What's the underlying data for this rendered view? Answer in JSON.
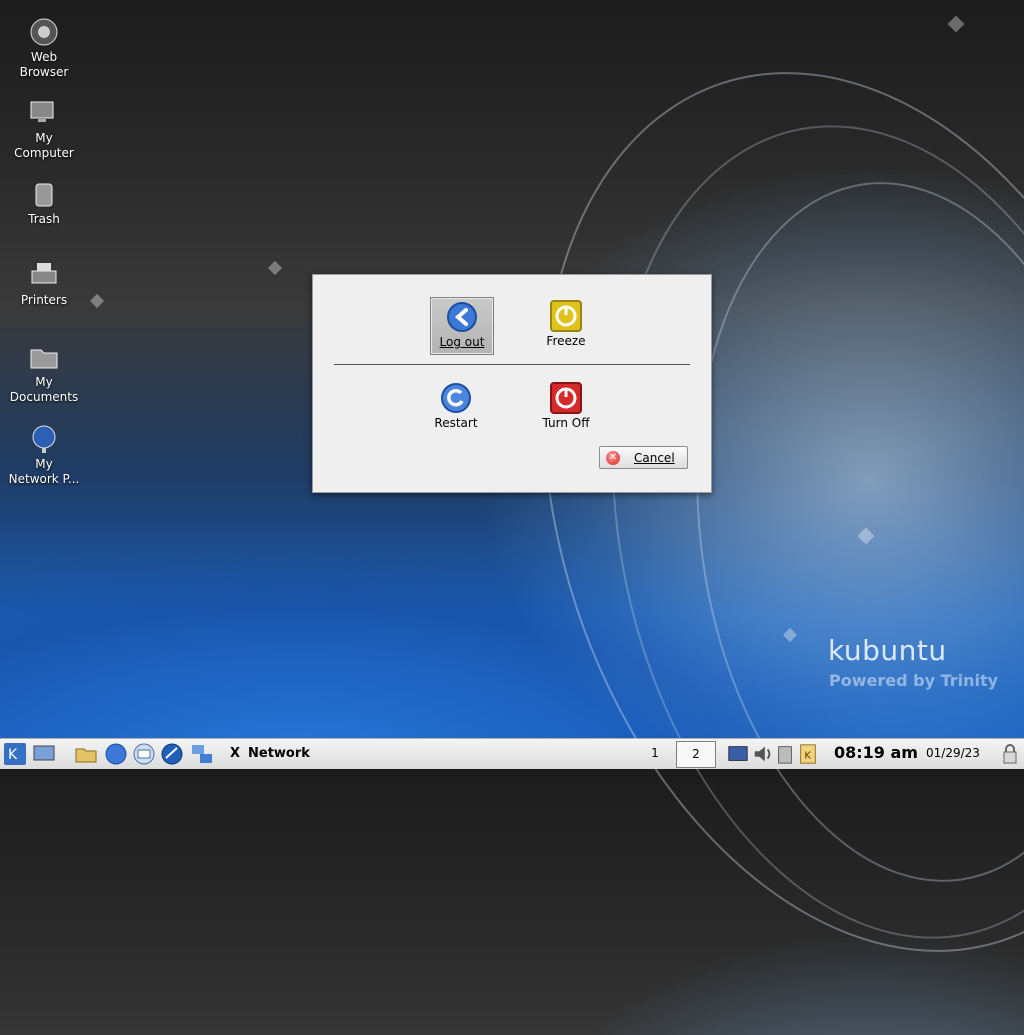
{
  "desktop": {
    "icons": [
      {
        "label": "Web\nBrowser",
        "icon": "web-browser-icon"
      },
      {
        "label": "My\nComputer",
        "icon": "computer-icon"
      },
      {
        "label": "Trash",
        "icon": "trash-icon"
      },
      {
        "label": "Printers",
        "icon": "printer-icon"
      },
      {
        "label": "My\nDocuments",
        "icon": "folder-icon"
      },
      {
        "label": "My\nNetwork P...",
        "icon": "network-globe-icon"
      }
    ]
  },
  "dialog": {
    "logout": "Log out",
    "freeze": "Freeze",
    "restart": "Restart",
    "turnoff": "Turn Off",
    "cancel": "Cancel"
  },
  "branding": {
    "name": "kubuntu",
    "sub": "Powered by Trinity"
  },
  "taskbar": {
    "task_label": "Network",
    "pager": [
      "1",
      "2"
    ],
    "clock": "08:19 am",
    "date": "01/29/23"
  },
  "colors": {
    "dialog_bg": "#efefef",
    "logout_blue": "#3b78d8",
    "freeze_yellow": "#e0c21c",
    "turnoff_red": "#d42a2a",
    "taskbar_bg": "#e6e6e6"
  }
}
